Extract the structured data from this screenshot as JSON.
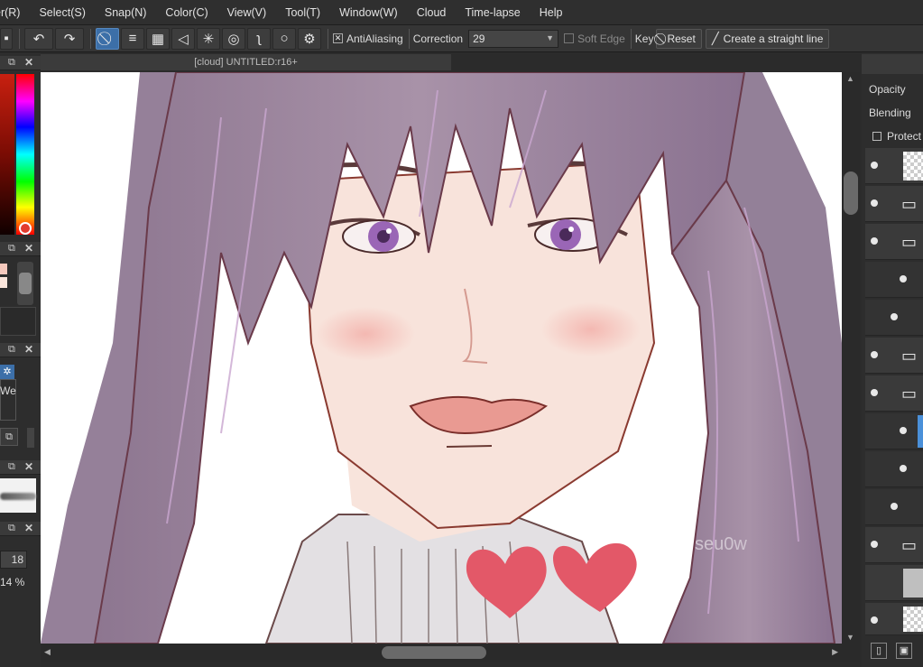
{
  "menu": [
    "er(R)",
    "Select(S)",
    "Snap(N)",
    "Color(C)",
    "View(V)",
    "Tool(T)",
    "Window(W)",
    "Cloud",
    "Time-lapse",
    "Help"
  ],
  "toolbar": {
    "antialiasing_label": "AntiAliasing",
    "correction_label": "Correction",
    "correction_value": "29",
    "soft_edge_label": "Soft Edge",
    "key_label": "Key",
    "reset_label": "Reset",
    "straight_line_label": "Create a straight line"
  },
  "document": {
    "tab_title": "[cloud] UNTITLED:r16+",
    "watermark": "seu0w"
  },
  "left_panel": {
    "wet_label": "We",
    "brush_size": "18",
    "zoom": "14 %"
  },
  "right_panel": {
    "opacity_label": "Opacity",
    "blending_label": "Blending",
    "protect_label": "Protect"
  },
  "colors": {
    "accent": "#3c6fa8",
    "heart": "#e55a6a",
    "hair": "#9a7f9a",
    "skin": "#f6ddd5"
  }
}
